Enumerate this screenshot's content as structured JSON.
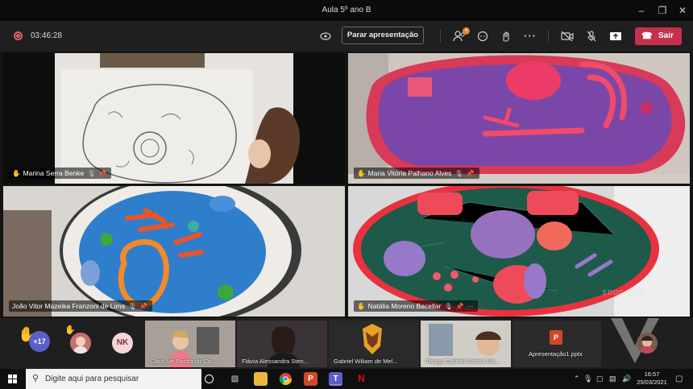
{
  "window": {
    "title": "Aula 5º ano B",
    "minimize_icon": "minimize-icon",
    "maximize_icon": "restore-icon",
    "close_icon": "close-icon"
  },
  "meeting": {
    "recording_icon": "record-icon",
    "elapsed": "03:46:28",
    "stop_presenting_label": "Parar apresentação",
    "participants_badge": "4",
    "leave_label": "Sair",
    "accent_leave": "#c4314b",
    "accent_brand": "#5b5fc7"
  },
  "videos": [
    {
      "name": "Marina Serra Benke",
      "hand_raised": true
    },
    {
      "name": "Maria Vitória Palhano Alves",
      "hand_raised": true
    },
    {
      "name": "João Vitor Mazeika Franzoni de Lima",
      "hand_raised": false
    },
    {
      "name": "Natália Moreno Bacellar",
      "hand_raised": true,
      "more": "···"
    }
  ],
  "gallery": {
    "more_count": "+17",
    "avatar_initials": "NK",
    "thumbs": [
      {
        "name": "Clara Ive Rocha do Ca..."
      },
      {
        "name": "Flávia Alessandra Sten..."
      },
      {
        "name": "Gabriel Wiliam de Mel..."
      },
      {
        "name": "Thiago Gabriel Martini Ma..."
      },
      {
        "name": "Apresentação1.pptx"
      }
    ],
    "watermark": "EDUCAÇÃO"
  },
  "taskbar": {
    "search_placeholder": "Digite aqui para pesquisar",
    "time": "16:57",
    "date": "25/03/2021"
  }
}
